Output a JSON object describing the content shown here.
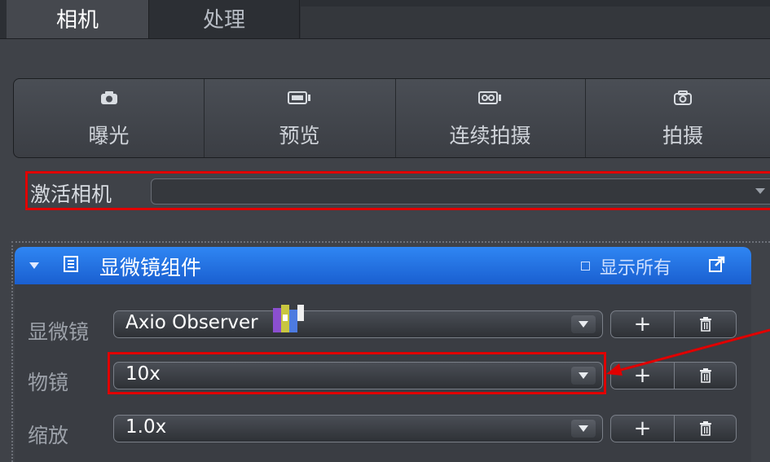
{
  "tabs": [
    {
      "label": "相机",
      "active": true
    },
    {
      "label": "处理",
      "active": false
    }
  ],
  "toolbar": {
    "buttons": [
      {
        "label": "曝光",
        "icon": "camera-icon"
      },
      {
        "label": "预览",
        "icon": "video-preview-icon"
      },
      {
        "label": "连续拍摄",
        "icon": "continuous-video-icon"
      },
      {
        "label": "拍摄",
        "icon": "snap-camera-icon"
      }
    ]
  },
  "active_camera": {
    "label": "激活相机",
    "value": ""
  },
  "panel": {
    "title": "显微镜组件",
    "show_all": "显示所有",
    "rows": [
      {
        "label": "显微镜",
        "value": "Axio Observer"
      },
      {
        "label": "物镜",
        "value": "10x"
      },
      {
        "label": "缩放",
        "value": "1.0x"
      }
    ],
    "add_symbol": "+"
  },
  "colors": {
    "accent_blue": "#2f86f3",
    "highlight_red": "#e00000",
    "background": "#3f4248"
  }
}
